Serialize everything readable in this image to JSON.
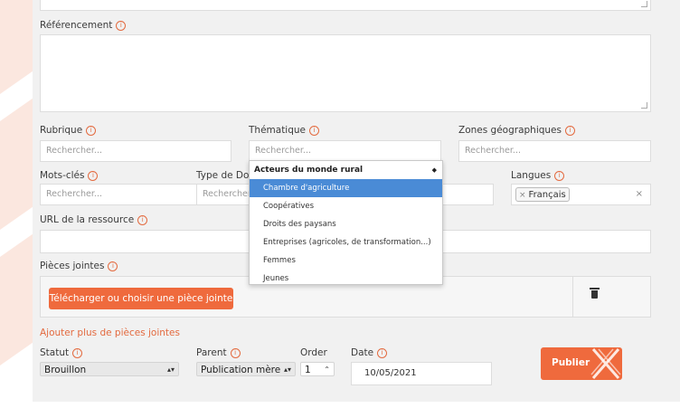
{
  "referencement": {
    "label": "Référencement"
  },
  "rubrique": {
    "label": "Rubrique",
    "placeholder": "Rechercher..."
  },
  "thematique": {
    "label": "Thématique",
    "placeholder": "Rechercher...",
    "dropdown": {
      "group": "Acteurs du monde rural",
      "items": [
        "Chambre d'agriculture",
        "Coopératives",
        "Droits des paysans",
        "Entreprises (agricoles, de transformation...)",
        "Femmes",
        "Jeunes"
      ],
      "selected_index": 0
    }
  },
  "zones": {
    "label": "Zones géographiques",
    "placeholder": "Rechercher..."
  },
  "motscles": {
    "label": "Mots-clés",
    "placeholder": "Rechercher..."
  },
  "typedoc": {
    "label": "Type de Docu",
    "placeholder": "Rechercher..."
  },
  "langues": {
    "label": "Langues",
    "tag": "Français",
    "tag_remove": "×",
    "clear": "×"
  },
  "url": {
    "label": "URL de la ressource"
  },
  "pieces": {
    "label": "Pièces jointes",
    "upload_button": "Télécharger ou choisir une pièce jointe",
    "add_more": "Ajouter plus de pièces jointes"
  },
  "statut": {
    "label": "Statut",
    "value": "Brouillon"
  },
  "parent": {
    "label": "Parent",
    "value": "Publication mère"
  },
  "order": {
    "label": "Order",
    "value": "1"
  },
  "date": {
    "label": "Date",
    "value": "10/05/2021"
  },
  "publish": {
    "label": "Publier"
  },
  "colors": {
    "accent": "#ef6a3d",
    "panel": "#f1f1f1",
    "selected": "#4a8bd6"
  }
}
